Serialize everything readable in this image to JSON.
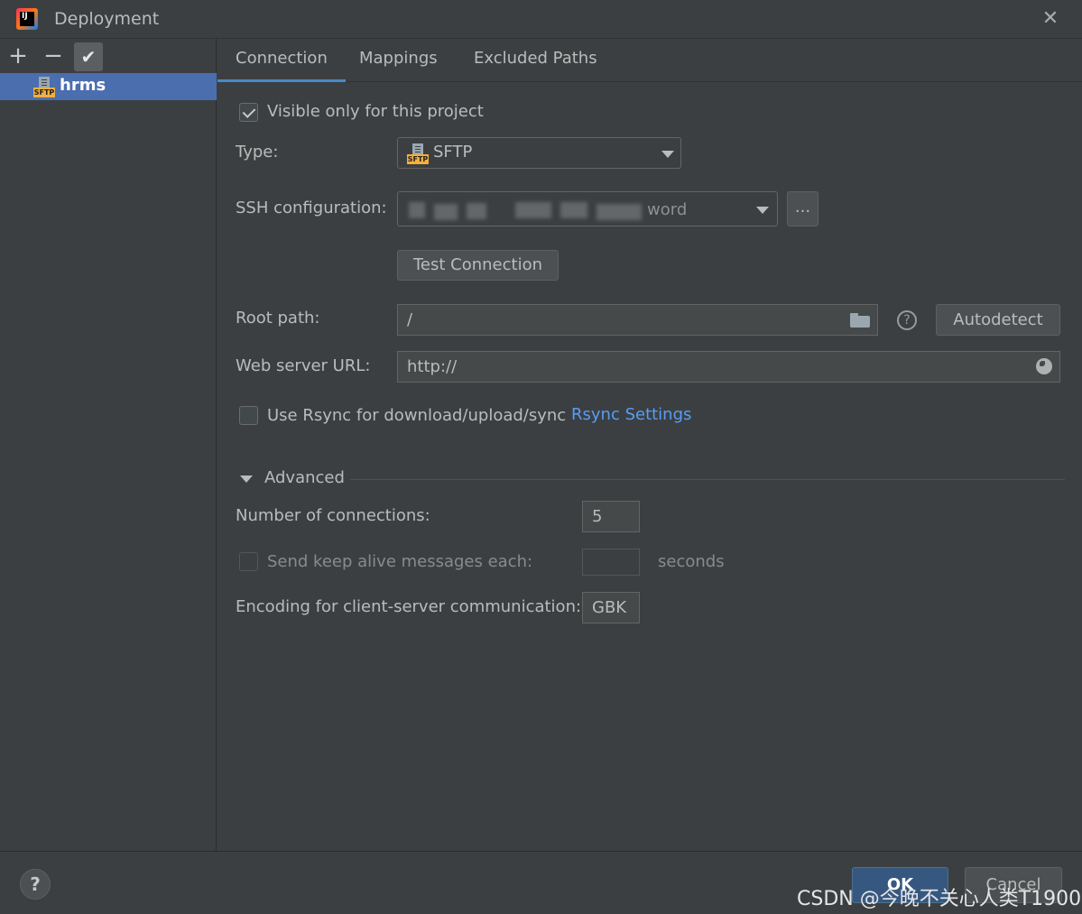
{
  "window": {
    "title": "Deployment",
    "app_icon_text": "IJ"
  },
  "sidebar": {
    "servers": [
      {
        "name": "hrms",
        "icon_label": "SFTP",
        "selected": true
      }
    ]
  },
  "tabs": [
    {
      "label": "Connection",
      "active": true
    },
    {
      "label": "Mappings",
      "active": false
    },
    {
      "label": "Excluded Paths",
      "active": false
    }
  ],
  "connection": {
    "visible_only_label": "Visible only for this project",
    "visible_only_checked": true,
    "type_label": "Type:",
    "type_value": "SFTP",
    "type_icon_label": "SFTP",
    "ssh_label": "SSH configuration:",
    "ssh_value_visible_suffix": "word",
    "ssh_more_button": "...",
    "test_connection_button": "Test Connection",
    "root_path_label": "Root path:",
    "root_path_value": "/",
    "help_symbol": "?",
    "autodetect_button": "Autodetect",
    "web_url_label": "Web server URL:",
    "web_url_value": "http://",
    "rsync_label": "Use Rsync for download/upload/sync",
    "rsync_checked": false,
    "rsync_settings_link": "Rsync Settings"
  },
  "advanced": {
    "header": "Advanced",
    "connections_label": "Number of connections:",
    "connections_value": "5",
    "keep_alive_label": "Send keep alive messages each:",
    "keep_alive_checked": false,
    "keep_alive_value": "",
    "seconds_label": "seconds",
    "encoding_label": "Encoding for client-server communication:",
    "encoding_value": "GBK"
  },
  "footer": {
    "help_symbol": "?",
    "ok_button": "OK",
    "cancel_button": "Cancel",
    "watermark": "CSDN @今晚不关心人类T1900"
  },
  "colors": {
    "background": "#3c3f41",
    "selection": "#4b6eaf",
    "tab_underline": "#4a88c7",
    "link": "#589df6",
    "sftp_tag": "#f4af3d"
  }
}
